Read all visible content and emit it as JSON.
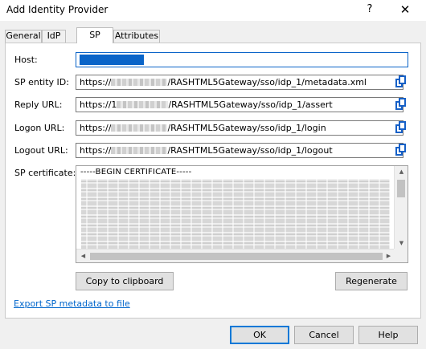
{
  "window": {
    "title": "Add Identity Provider",
    "help_label": "?",
    "close_label": "✕"
  },
  "tabs": [
    {
      "label": "General"
    },
    {
      "label": "IdP"
    },
    {
      "label": "SP",
      "active": true
    },
    {
      "label": "Attributes"
    }
  ],
  "form": {
    "host": {
      "label": "Host:"
    },
    "entity_id": {
      "label": "SP entity ID:",
      "prefix": "https://",
      "suffix": "/RASHTML5Gateway/sso/idp_1/metadata.xml"
    },
    "reply_url": {
      "label": "Reply URL:",
      "prefix": "https://1",
      "suffix": "/RASHTML5Gateway/sso/idp_1/assert"
    },
    "logon_url": {
      "label": "Logon URL:",
      "prefix": "https://",
      "suffix": "/RASHTML5Gateway/sso/idp_1/login"
    },
    "logout_url": {
      "label": "Logout URL:",
      "prefix": "https://",
      "suffix": "/RASHTML5Gateway/sso/idp_1/logout"
    },
    "certificate": {
      "label": "SP certificate:",
      "header": "-----BEGIN CERTIFICATE-----"
    }
  },
  "buttons": {
    "copy_clipboard": "Copy to clipboard",
    "regenerate": "Regenerate",
    "ok": "OK",
    "cancel": "Cancel",
    "help": "Help"
  },
  "link": {
    "export_metadata": "Export SP metadata to file"
  },
  "icons": {
    "copy": "copy-icon",
    "close": "close-icon"
  },
  "colors": {
    "accent": "#0078d7",
    "link": "#0066cc",
    "icon": "#1660c7"
  }
}
